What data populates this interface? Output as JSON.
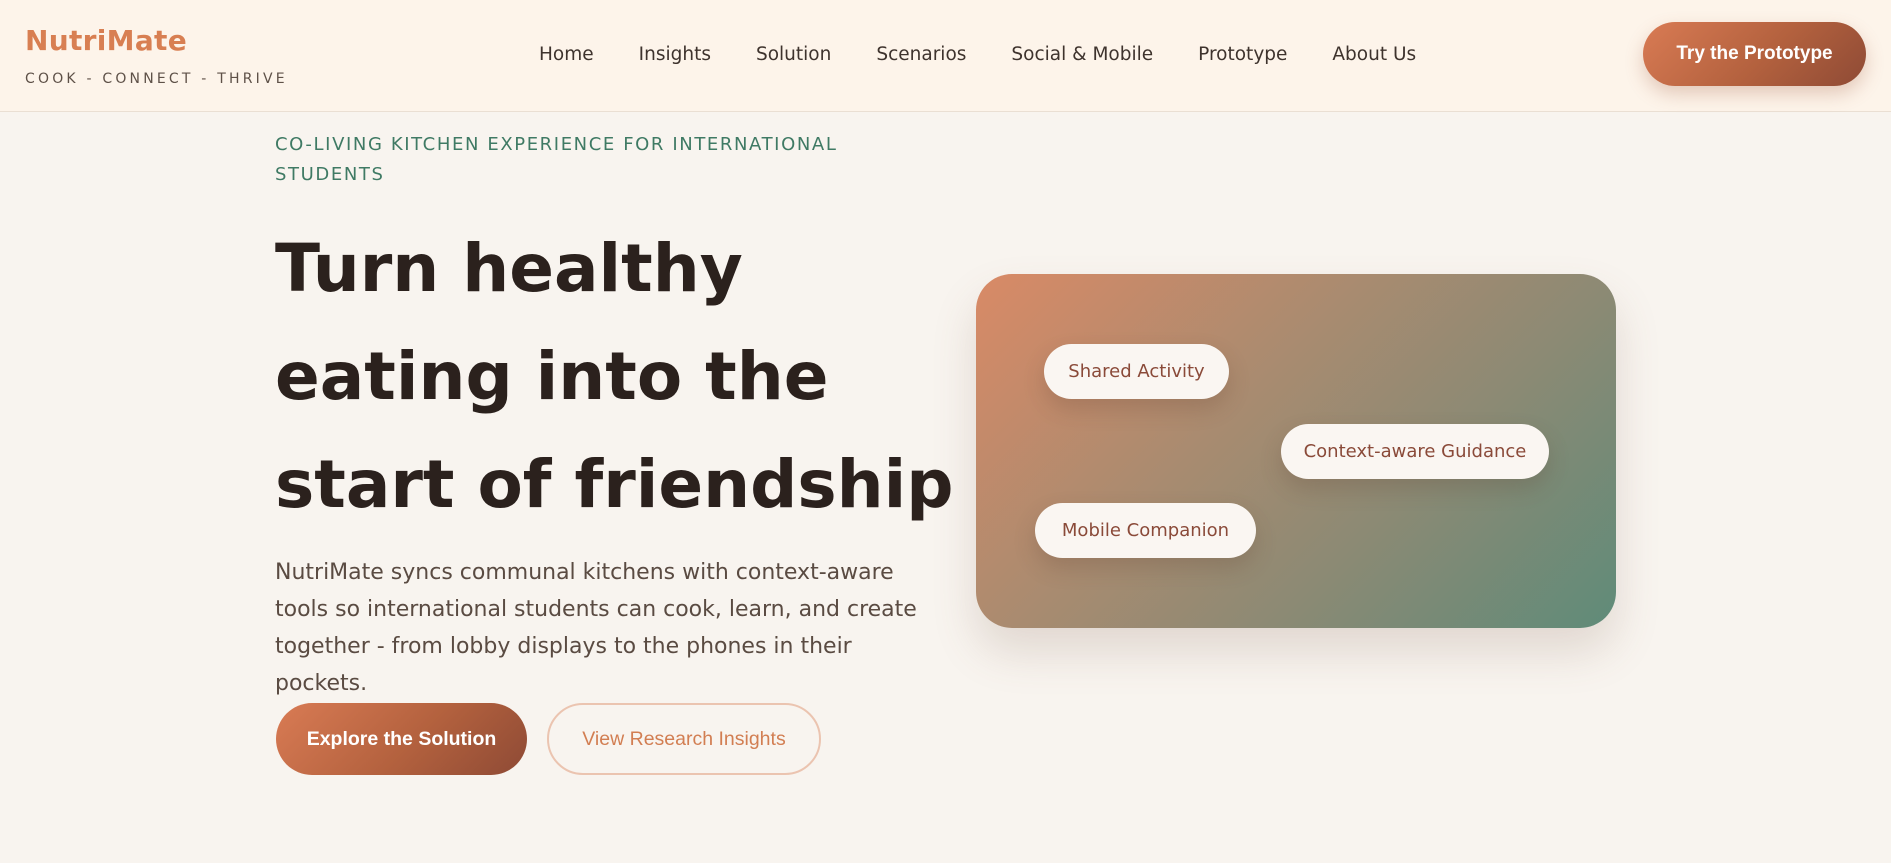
{
  "brand": {
    "name": "NutriMate",
    "tagline": "COOK - CONNECT - THRIVE"
  },
  "nav": {
    "items": [
      "Home",
      "Insights",
      "Solution",
      "Scenarios",
      "Social & Mobile",
      "Prototype",
      "About Us"
    ],
    "cta_label": "Try the Prototype"
  },
  "hero": {
    "eyebrow": "CO-LIVING KITCHEN EXPERIENCE FOR INTERNATIONAL STUDENTS",
    "title": "Turn healthy eating into the start of friendship",
    "description": "NutriMate syncs communal kitchens with context-aware tools so international students can cook, learn, and create together - from lobby displays to the phones in their pockets.",
    "primary_button": "Explore the Solution",
    "secondary_button": "View Research Insights"
  },
  "card": {
    "chips": [
      "Shared Activity",
      "Context-aware Guidance",
      "Mobile Companion"
    ]
  },
  "colors": {
    "accent": "#d87f52",
    "eyebrow": "#3f7a64",
    "background": "#f8f4ef",
    "header_background": "#fdf4ea"
  }
}
